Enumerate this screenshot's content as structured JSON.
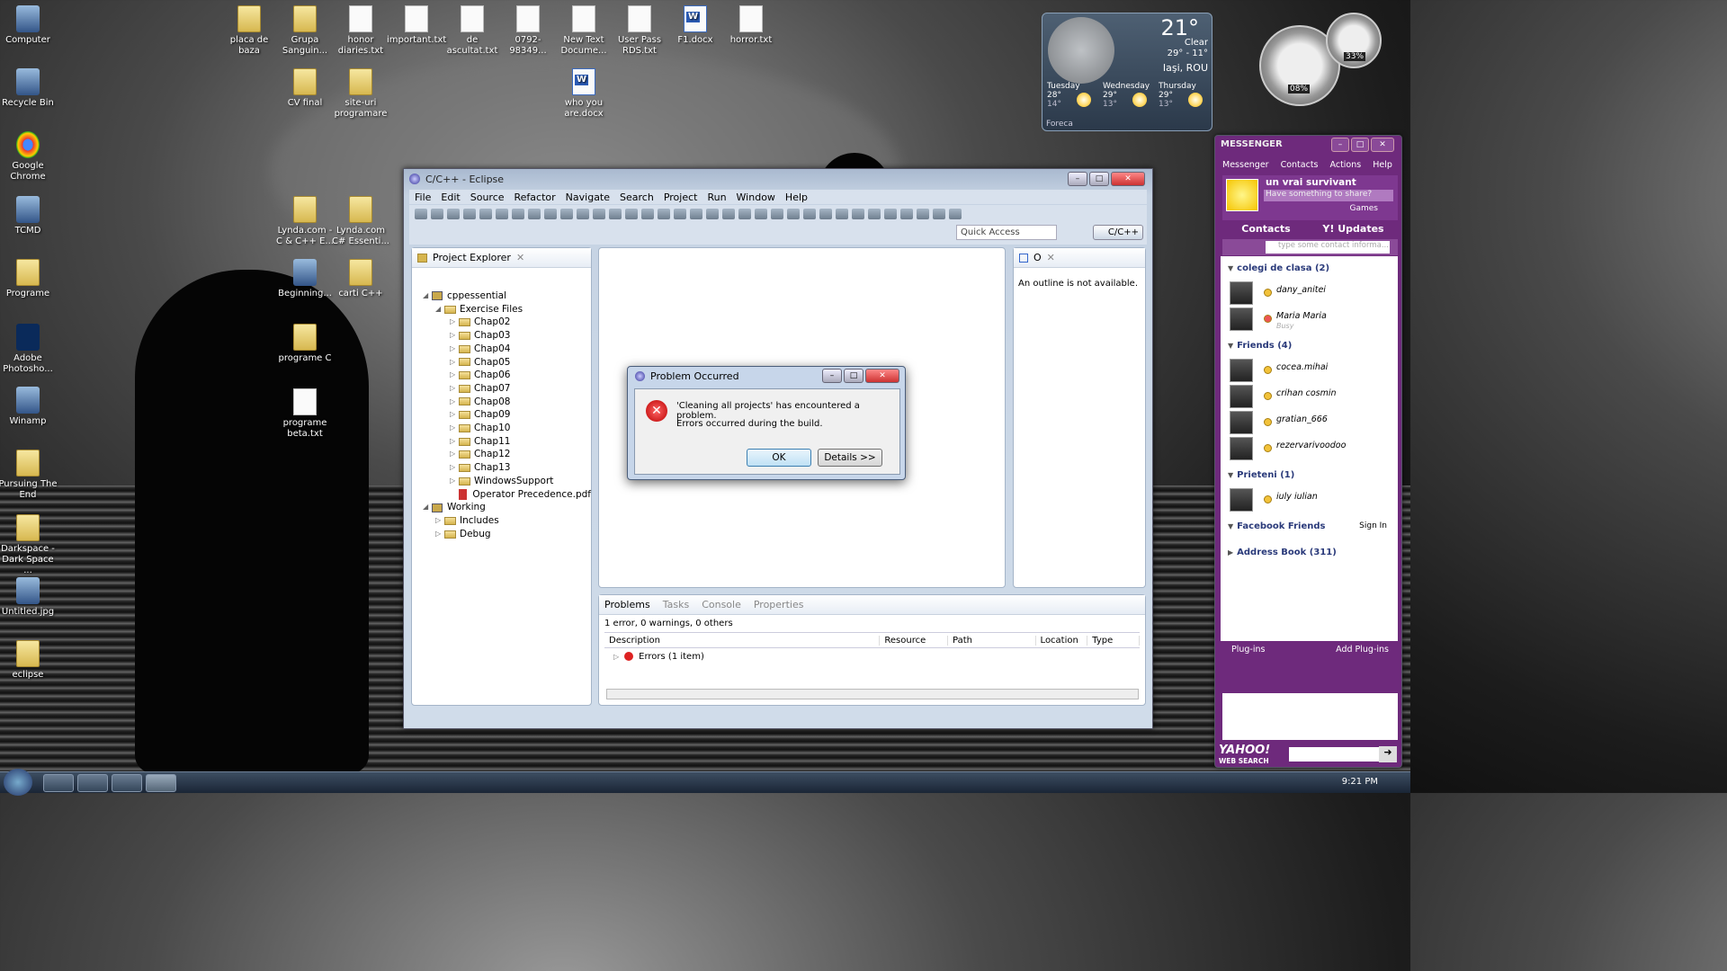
{
  "desktop_icons": [
    {
      "label": "Computer",
      "kind": "pc"
    },
    {
      "label": "Recycle Bin",
      "kind": "bin"
    },
    {
      "label": "Google Chrome",
      "kind": "chrome"
    },
    {
      "label": "TCMD",
      "kind": "app"
    },
    {
      "label": "Programe",
      "kind": "folder"
    },
    {
      "label": "Adobe Photosho...",
      "kind": "ps"
    },
    {
      "label": "Winamp",
      "kind": "app"
    },
    {
      "label": "Pursuing The End",
      "kind": "folder"
    },
    {
      "label": "Darkspace - Dark Space ...",
      "kind": "folder"
    },
    {
      "label": "Untitled.jpg",
      "kind": "img"
    },
    {
      "label": "eclipse",
      "kind": "folder"
    },
    {
      "label": "placa de baza",
      "kind": "folder"
    },
    {
      "label": "Grupa Sanguin...",
      "kind": "folder"
    },
    {
      "label": "honor diaries.txt",
      "kind": "file"
    },
    {
      "label": "important.txt",
      "kind": "file"
    },
    {
      "label": "de ascultat.txt",
      "kind": "file"
    },
    {
      "label": "0792-98349...",
      "kind": "file"
    },
    {
      "label": "New Text Docume...",
      "kind": "file"
    },
    {
      "label": "User Pass RDS.txt",
      "kind": "file"
    },
    {
      "label": "F1.docx",
      "kind": "docx"
    },
    {
      "label": "horror.txt",
      "kind": "file"
    },
    {
      "label": "CV final",
      "kind": "folder"
    },
    {
      "label": "site-uri programare",
      "kind": "folder"
    },
    {
      "label": "who you are.docx",
      "kind": "docx"
    },
    {
      "label": "Lynda.com - C & C++ E...",
      "kind": "folder"
    },
    {
      "label": "Lynda.com C# Essenti...",
      "kind": "folder"
    },
    {
      "label": "Beginning...",
      "kind": "app"
    },
    {
      "label": "carti C++",
      "kind": "folder"
    },
    {
      "label": "programe C",
      "kind": "folder"
    },
    {
      "label": "programe beta.txt",
      "kind": "file"
    }
  ],
  "weather": {
    "temp": "21°",
    "condition": "Clear",
    "range": "29° - 11°",
    "location": "Iaşi, ROU",
    "days": [
      {
        "day": "Tuesday",
        "hi": "28°",
        "lo": "14°"
      },
      {
        "day": "Wednesday",
        "hi": "29°",
        "lo": "13°"
      },
      {
        "day": "Thursday",
        "hi": "29°",
        "lo": "13°"
      }
    ],
    "provider": "Foreca"
  },
  "gauges": {
    "cpu": "08%",
    "mem": "33%"
  },
  "eclipse": {
    "title": "C/C++ - Eclipse",
    "menu": [
      "File",
      "Edit",
      "Source",
      "Refactor",
      "Navigate",
      "Search",
      "Project",
      "Run",
      "Window",
      "Help"
    ],
    "quick_access": "Quick Access",
    "perspective": "C/C++",
    "project_explorer_title": "Project Explorer",
    "tree": {
      "project": "cppessential",
      "exercise": "Exercise Files",
      "chapters": [
        "Chap02",
        "Chap03",
        "Chap04",
        "Chap05",
        "Chap06",
        "Chap07",
        "Chap08",
        "Chap09",
        "Chap10",
        "Chap11",
        "Chap12",
        "Chap13",
        "WindowsSupport"
      ],
      "pdf": "Operator Precedence.pdf",
      "working": "Working",
      "includes": "Includes",
      "debug": "Debug"
    },
    "outline_tab": "O",
    "outline_msg": "An outline is not available.",
    "bottom_tabs": [
      "Problems",
      "Tasks",
      "Console",
      "Properties"
    ],
    "problems_summary": "1 error, 0 warnings, 0 others",
    "columns": [
      "Description",
      "Resource",
      "Path",
      "Location",
      "Type"
    ],
    "error_row": "Errors (1 item)"
  },
  "dialog": {
    "title": "Problem Occurred",
    "message": "'Cleaning all projects' has encountered a problem.",
    "detail": "Errors occurred during the build.",
    "ok": "OK",
    "details": "Details >>"
  },
  "messenger": {
    "title": "MESSENGER",
    "menu": [
      "Messenger",
      "Contacts",
      "Actions",
      "Help"
    ],
    "user": "un vrai survivant",
    "status_placeholder": "Have something to share?",
    "games": "Games",
    "tab_contacts": "Contacts",
    "tab_updates": "Y! Updates",
    "search_placeholder": "type some contact informa...",
    "groups": [
      {
        "name": "colegi de clasa (2)",
        "contacts": [
          {
            "name": "dany_anitei",
            "status": ""
          },
          {
            "name": "Maria Maria",
            "status": "Busy"
          }
        ]
      },
      {
        "name": "Friends (4)",
        "contacts": [
          {
            "name": "cocea.mihai",
            "status": ""
          },
          {
            "name": "crihan cosmin",
            "status": ""
          },
          {
            "name": "gratian_666",
            "status": ""
          },
          {
            "name": "rezervarivoodoo",
            "status": ""
          }
        ]
      },
      {
        "name": "Prieteni (1)",
        "contacts": [
          {
            "name": "iuly iulian",
            "status": ""
          }
        ]
      }
    ],
    "facebook": "Facebook Friends",
    "sign_in": "Sign In",
    "address_book": "Address Book (311)",
    "plugins": "Plug-ins",
    "add_plugins": "Add Plug-ins",
    "yahoo_search": "WEB SEARCH"
  },
  "clock": "9:21 PM"
}
